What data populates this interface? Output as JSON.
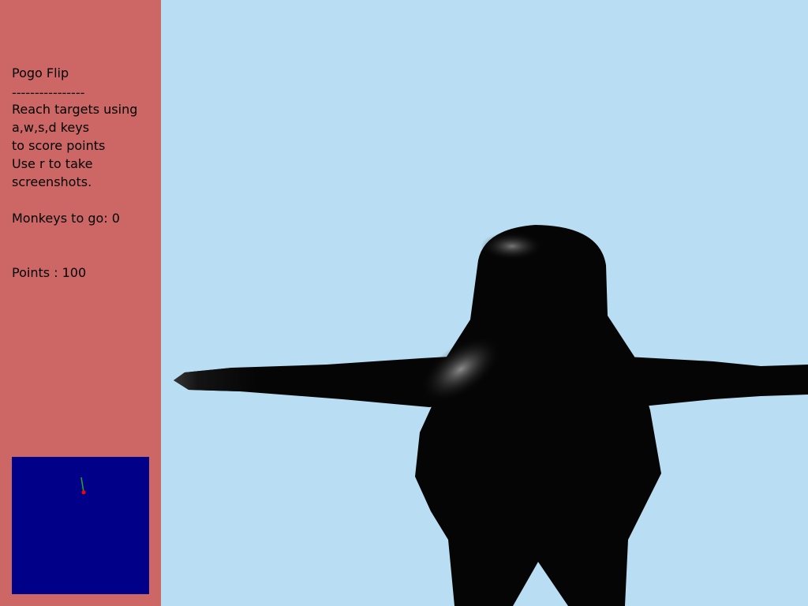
{
  "colors": {
    "sidebar_bg": "#cd6766",
    "sky_bg": "#b9ddf2",
    "minimap_bg": "#000088",
    "player_body": "#050505",
    "minimap_player_dot": "#ff0000",
    "minimap_heading_line": "#22aa22"
  },
  "hud": {
    "title": "Pogo Flip",
    "divider": "----------------",
    "instructions": [
      "Reach targets using",
      "a,w,s,d keys",
      "to score points",
      "Use r to take",
      "screenshots."
    ],
    "monkeys_label": "Monkeys to go: 0",
    "points_label": "Points : 100"
  },
  "minimap": {
    "player_marker": "red-dot",
    "heading_marker": "green-line"
  },
  "scene": {
    "character": "black-penguin-silhouette",
    "background": "sky"
  }
}
